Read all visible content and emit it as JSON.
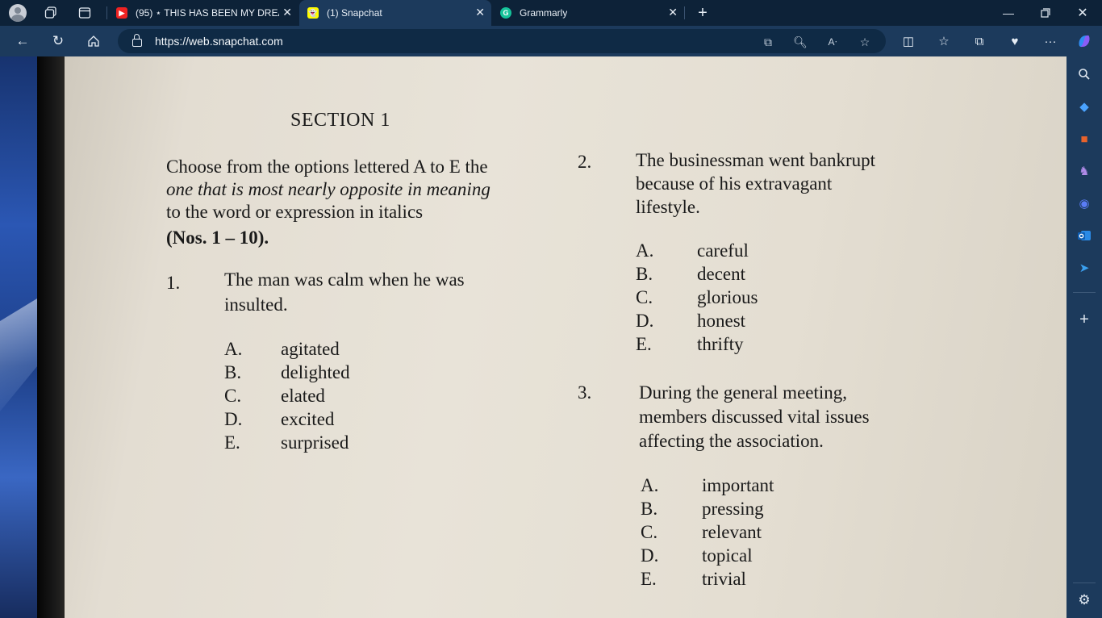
{
  "browser": {
    "tabs": [
      {
        "label": "(95) ⋆ THIS HAS BEEN MY DREA",
        "favicon": "youtube-icon",
        "active": false
      },
      {
        "label": "(1) Snapchat",
        "favicon": "snapchat-icon",
        "active": true
      },
      {
        "label": "Grammarly",
        "favicon": "grammarly-icon",
        "active": false
      }
    ],
    "url": "https://web.snapchat.com"
  },
  "worksheet": {
    "section_title": "SECTION 1",
    "instructions": [
      "Choose from the options lettered A to E the",
      "one that is most nearly opposite in meaning",
      "to the word or expression in italics",
      "(Nos. 1 – 10)."
    ],
    "questions": [
      {
        "number": "1.",
        "text_lines": [
          "The man was calm when he was",
          "insulted."
        ],
        "options": [
          {
            "letter": "A.",
            "text": "agitated"
          },
          {
            "letter": "B.",
            "text": "delighted"
          },
          {
            "letter": "C.",
            "text": "elated"
          },
          {
            "letter": "D.",
            "text": "excited"
          },
          {
            "letter": "E.",
            "text": "surprised"
          }
        ]
      },
      {
        "number": "2.",
        "text_lines": [
          "The businessman went bankrupt",
          "because of his extravagant",
          "lifestyle."
        ],
        "options": [
          {
            "letter": "A.",
            "text": "careful"
          },
          {
            "letter": "B.",
            "text": "decent"
          },
          {
            "letter": "C.",
            "text": "glorious"
          },
          {
            "letter": "D.",
            "text": "honest"
          },
          {
            "letter": "E.",
            "text": "thrifty"
          }
        ]
      },
      {
        "number": "3.",
        "text_lines": [
          "During the general meeting,",
          "members discussed vital issues",
          "affecting the association."
        ],
        "options": [
          {
            "letter": "A.",
            "text": "important"
          },
          {
            "letter": "B.",
            "text": "pressing"
          },
          {
            "letter": "C.",
            "text": "relevant"
          },
          {
            "letter": "D.",
            "text": "topical"
          },
          {
            "letter": "E.",
            "text": "trivial"
          }
        ]
      }
    ]
  },
  "colors": {
    "titlebar": "#0d2238",
    "toolbar": "#1c3a5c",
    "paper": "#e6e0d5"
  }
}
